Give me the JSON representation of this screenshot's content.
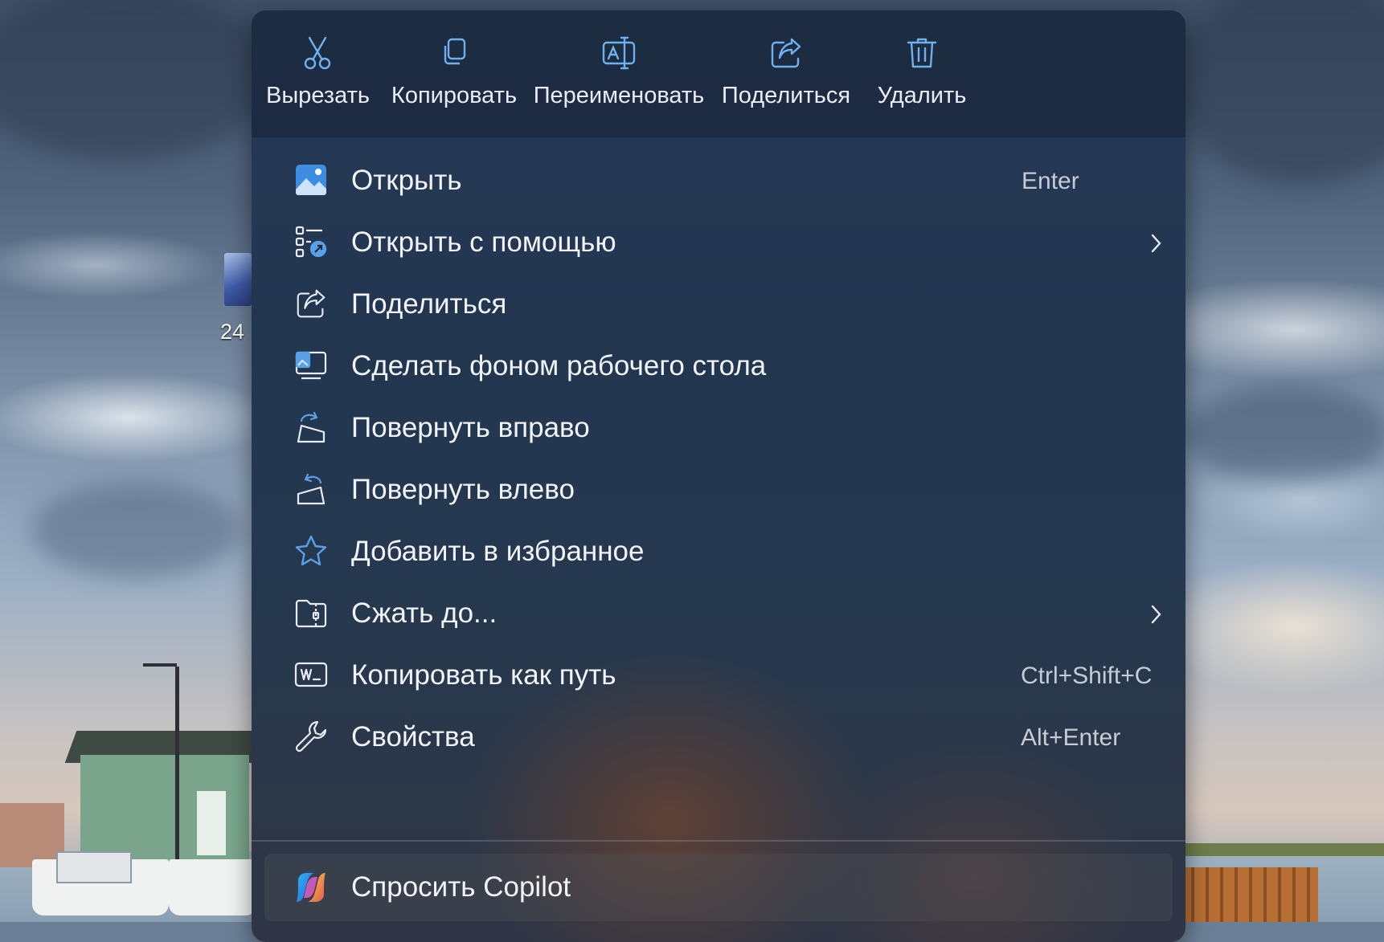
{
  "desktop": {
    "icon_label": "24"
  },
  "toolbar": {
    "items": [
      {
        "label": "Вырезать",
        "icon": "scissors-icon"
      },
      {
        "label": "Копировать",
        "icon": "copy-icon"
      },
      {
        "label": "Переименовать",
        "icon": "rename-icon"
      },
      {
        "label": "Поделиться",
        "icon": "share-icon"
      },
      {
        "label": "Удалить",
        "icon": "trash-icon"
      }
    ]
  },
  "menu": {
    "items": [
      {
        "label": "Открыть",
        "shortcut": "Enter",
        "icon": "image-open-icon"
      },
      {
        "label": "Открыть с помощью",
        "submenu": true,
        "icon": "open-with-icon"
      },
      {
        "label": "Поделиться",
        "icon": "share-icon"
      },
      {
        "label": "Сделать фоном рабочего стола",
        "icon": "set-wallpaper-icon"
      },
      {
        "label": "Повернуть вправо",
        "icon": "rotate-right-icon"
      },
      {
        "label": "Повернуть влево",
        "icon": "rotate-left-icon"
      },
      {
        "label": "Добавить в избранное",
        "icon": "star-icon"
      },
      {
        "label": "Сжать до...",
        "submenu": true,
        "icon": "zip-folder-icon"
      },
      {
        "label": "Копировать как путь",
        "shortcut": "Ctrl+Shift+C",
        "icon": "copy-path-icon"
      },
      {
        "label": "Свойства",
        "shortcut": "Alt+Enter",
        "icon": "wrench-icon"
      }
    ],
    "copilot": {
      "label": "Спросить Copilot",
      "icon": "copilot-icon"
    }
  },
  "colors": {
    "accent": "#5aa0e6",
    "menu_text": "#f1f3f6",
    "shortcut_text": "#c7ccd4"
  }
}
